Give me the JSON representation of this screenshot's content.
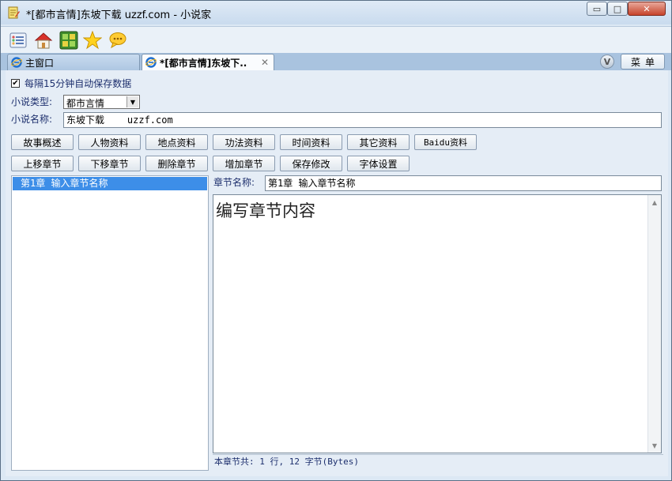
{
  "window": {
    "title": "*[都市言情]东坡下载   uzzf.com - 小说家",
    "controls": {
      "minimize": "▭",
      "maximize": "□",
      "close": "✕"
    }
  },
  "toolbar": {
    "icons": [
      "list-icon",
      "home-icon",
      "grid-icon",
      "star-icon",
      "chat-icon"
    ]
  },
  "tabs": [
    {
      "label": "主窗口",
      "active": false
    },
    {
      "label": "*[都市言情]东坡下..",
      "active": true,
      "close": "✕"
    }
  ],
  "tab_right": {
    "v_label": "V",
    "menu_label": "菜单"
  },
  "form": {
    "autosave_checked": true,
    "autosave_mark": "✔",
    "autosave_label": "每隔15分钟自动保存数据",
    "type_label": "小说类型:",
    "type_value": "都市言情",
    "name_label": "小说名称:",
    "name_value": "东坡下载    uzzf.com"
  },
  "buttons": {
    "row1": [
      "故事概述",
      "人物资料",
      "地点资料",
      "功法资料",
      "时间资料",
      "其它资料",
      "Baidu资料"
    ],
    "row2": [
      "上移章节",
      "下移章节",
      "删除章节",
      "增加章节",
      "保存修改",
      "字体设置"
    ]
  },
  "chapters": [
    {
      "label": "第1章  输入章节名称",
      "selected": true
    }
  ],
  "chapter_editor": {
    "name_label": "章节名称:",
    "name_value": "第1章 输入章节名称",
    "content": "编写章节内容",
    "status": "本章节共: 1 行, 12 字节(Bytes)"
  },
  "colors": {
    "selection": "#3d8ee8",
    "label_text": "#1d2f6d"
  }
}
